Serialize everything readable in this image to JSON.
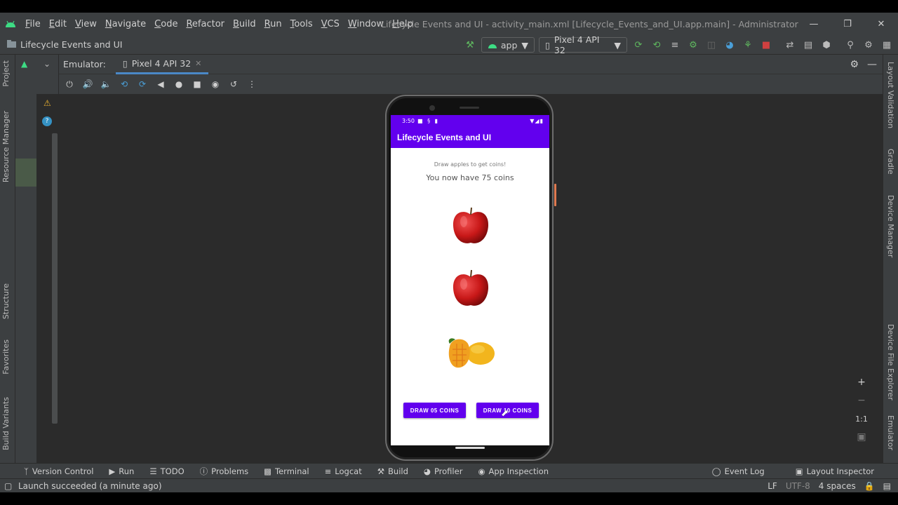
{
  "menu": [
    "File",
    "Edit",
    "View",
    "Navigate",
    "Code",
    "Refactor",
    "Build",
    "Run",
    "Tools",
    "VCS",
    "Window",
    "Help"
  ],
  "window_title": "Lifecycle Events and UI - activity_main.xml [Lifecycle_Events_and_UI.app.main] - Administrator",
  "breadcrumb": "Lifecycle Events and UI",
  "run_config": "app",
  "device": "Pixel 4 API 32",
  "emulator_label": "Emulator:",
  "emulator_tab": "Pixel 4 API 32",
  "left_tabs": [
    "Project",
    "Resource Manager",
    "Structure",
    "Favorites",
    "Build Variants"
  ],
  "right_tabs": [
    "Layout Validation",
    "Gradle",
    "Device Manager",
    "Device File Explorer",
    "Emulator"
  ],
  "phone": {
    "time": "3:50",
    "app_title": "Lifecycle Events and UI",
    "hint": "Draw apples to get coins!",
    "coins_text": "You now have 75 coins",
    "fruits": [
      "apple",
      "apple",
      "mango"
    ],
    "btn_left": "DRAW 05 COINS",
    "btn_right": "DRAW 10 COINS"
  },
  "zoom": {
    "plus": "+",
    "minus": "−",
    "one": "1:1"
  },
  "bottom_tools": [
    "Version Control",
    "Run",
    "TODO",
    "Problems",
    "Terminal",
    "Logcat",
    "Build",
    "Profiler",
    "App Inspection"
  ],
  "bottom_right_tools": [
    "Event Log",
    "Layout Inspector"
  ],
  "status": {
    "message": "Launch succeeded (a minute ago)",
    "line_sep": "LF",
    "encoding": "UTF-8",
    "indent": "4 spaces"
  },
  "colors": {
    "accent": "#6200ee",
    "ide_bg": "#3c3f41",
    "editor_bg": "#2b2b2b",
    "android_green": "#3ddc84"
  }
}
